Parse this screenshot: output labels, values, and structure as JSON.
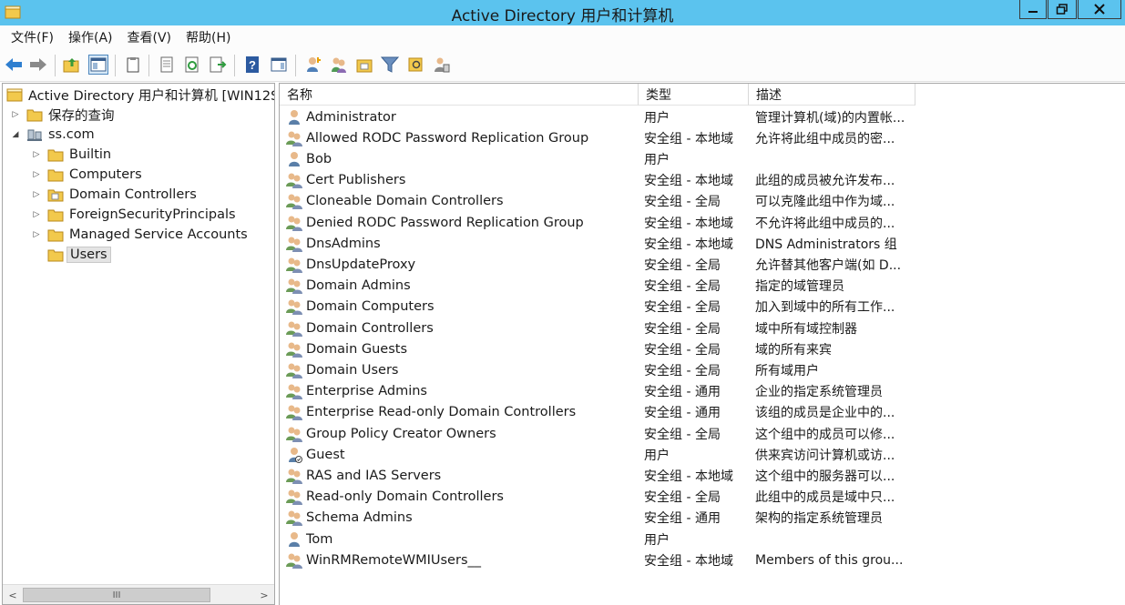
{
  "window": {
    "title": "Active Directory 用户和计算机"
  },
  "menu": [
    {
      "label": "文件(F)"
    },
    {
      "label": "操作(A)"
    },
    {
      "label": "查看(V)"
    },
    {
      "label": "帮助(H)"
    }
  ],
  "toolbar": {
    "buttons": [
      "back-arrow-icon",
      "forward-arrow-icon",
      "up-folder-icon",
      "show-console-tree-icon",
      "copy-icon",
      "properties-icon",
      "refresh-icon",
      "export-list-icon",
      "help-icon",
      "action-pane-icon",
      "new-user-icon",
      "new-group-icon",
      "new-ou-icon",
      "filter-icon",
      "find-icon",
      "delegate-icon"
    ]
  },
  "tree": {
    "root": {
      "label": "Active Directory 用户和计算机 [WIN12S"
    },
    "saved_queries": {
      "label": "保存的查询"
    },
    "domain": {
      "label": "ss.com"
    },
    "children": [
      {
        "label": "Builtin"
      },
      {
        "label": "Computers"
      },
      {
        "label": "Domain Controllers"
      },
      {
        "label": "ForeignSecurityPrincipals"
      },
      {
        "label": "Managed Service Accounts"
      },
      {
        "label": "Users"
      }
    ],
    "scrollbar_thumb_label": "III"
  },
  "columns": {
    "name": "名称",
    "type": "类型",
    "description": "描述"
  },
  "rows": [
    {
      "name": "Administrator",
      "type": "用户",
      "description": "管理计算机(域)的内置帐...",
      "kind": "user"
    },
    {
      "name": "Allowed RODC Password Replication Group",
      "type": "安全组 - 本地域",
      "description": "允许将此组中成员的密...",
      "kind": "group"
    },
    {
      "name": "Bob",
      "type": "用户",
      "description": "",
      "kind": "user"
    },
    {
      "name": "Cert Publishers",
      "type": "安全组 - 本地域",
      "description": "此组的成员被允许发布...",
      "kind": "group"
    },
    {
      "name": "Cloneable Domain Controllers",
      "type": "安全组 - 全局",
      "description": "可以克隆此组中作为域...",
      "kind": "group"
    },
    {
      "name": "Denied RODC Password Replication Group",
      "type": "安全组 - 本地域",
      "description": "不允许将此组中成员的...",
      "kind": "group"
    },
    {
      "name": "DnsAdmins",
      "type": "安全组 - 本地域",
      "description": "DNS Administrators 组",
      "kind": "group"
    },
    {
      "name": "DnsUpdateProxy",
      "type": "安全组 - 全局",
      "description": "允许替其他客户端(如 D...",
      "kind": "group"
    },
    {
      "name": "Domain Admins",
      "type": "安全组 - 全局",
      "description": "指定的域管理员",
      "kind": "group"
    },
    {
      "name": "Domain Computers",
      "type": "安全组 - 全局",
      "description": "加入到域中的所有工作...",
      "kind": "group"
    },
    {
      "name": "Domain Controllers",
      "type": "安全组 - 全局",
      "description": "域中所有域控制器",
      "kind": "group"
    },
    {
      "name": "Domain Guests",
      "type": "安全组 - 全局",
      "description": "域的所有来宾",
      "kind": "group"
    },
    {
      "name": "Domain Users",
      "type": "安全组 - 全局",
      "description": "所有域用户",
      "kind": "group"
    },
    {
      "name": "Enterprise Admins",
      "type": "安全组 - 通用",
      "description": "企业的指定系统管理员",
      "kind": "group"
    },
    {
      "name": "Enterprise Read-only Domain Controllers",
      "type": "安全组 - 通用",
      "description": "该组的成员是企业中的...",
      "kind": "group"
    },
    {
      "name": "Group Policy Creator Owners",
      "type": "安全组 - 全局",
      "description": "这个组中的成员可以修...",
      "kind": "group"
    },
    {
      "name": "Guest",
      "type": "用户",
      "description": "供来宾访问计算机或访...",
      "kind": "user-disabled"
    },
    {
      "name": "RAS and IAS Servers",
      "type": "安全组 - 本地域",
      "description": "这个组中的服务器可以...",
      "kind": "group"
    },
    {
      "name": "Read-only Domain Controllers",
      "type": "安全组 - 全局",
      "description": "此组中的成员是域中只...",
      "kind": "group"
    },
    {
      "name": "Schema Admins",
      "type": "安全组 - 通用",
      "description": "架构的指定系统管理员",
      "kind": "group"
    },
    {
      "name": "Tom",
      "type": "用户",
      "description": "",
      "kind": "user"
    },
    {
      "name": "WinRMRemoteWMIUsers__",
      "type": "安全组 - 本地域",
      "description": "Members of this grou...",
      "kind": "group"
    }
  ],
  "colors": {
    "titlebar": "#5bc3ee",
    "folder": "#f2c94c",
    "selection": "#e4e4e4"
  }
}
